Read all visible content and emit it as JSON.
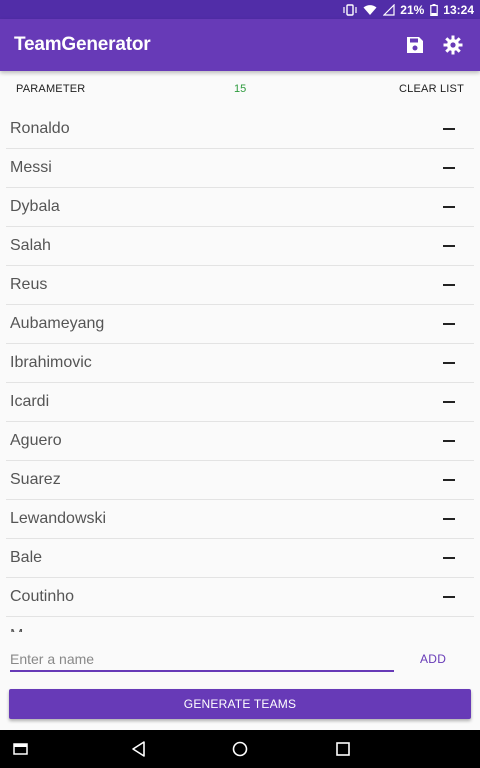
{
  "status_bar": {
    "battery_percent": "21%",
    "time": "13:24"
  },
  "app_bar": {
    "title": "TeamGenerator",
    "actions": [
      "save-icon",
      "settings-gear-icon"
    ]
  },
  "parameter_row": {
    "label": "PARAMETER",
    "value": "15",
    "clear_label": "CLEAR LIST"
  },
  "players": [
    {
      "name": "Ronaldo"
    },
    {
      "name": "Messi"
    },
    {
      "name": "Dybala"
    },
    {
      "name": "Salah"
    },
    {
      "name": "Reus"
    },
    {
      "name": "Aubameyang"
    },
    {
      "name": "Ibrahimovic"
    },
    {
      "name": "Icardi"
    },
    {
      "name": "Aguero"
    },
    {
      "name": "Suarez"
    },
    {
      "name": "Lewandowski"
    },
    {
      "name": "Bale"
    },
    {
      "name": "Coutinho"
    },
    {
      "name": "M"
    }
  ],
  "input": {
    "placeholder": "Enter a name",
    "value": ""
  },
  "add_label": "ADD",
  "generate_label": "GENERATE TEAMS",
  "colors": {
    "primary": "#673ab7",
    "primary_dark": "#512da8",
    "param_value": "#2e9b3e"
  },
  "nav_bar": [
    "recent-apps-icon",
    "back-icon",
    "home-icon",
    "overview-icon"
  ]
}
